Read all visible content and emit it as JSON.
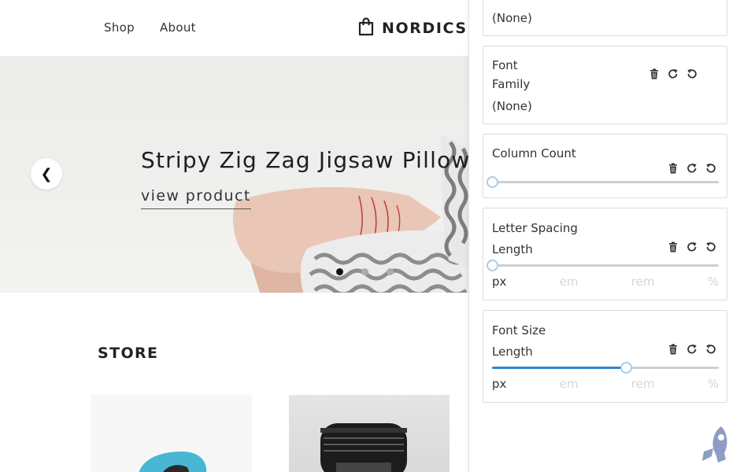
{
  "nav": {
    "links": [
      "Shop",
      "About"
    ],
    "brand": "NORDICS"
  },
  "hero": {
    "title": "Stripy Zig Zag Jigsaw Pillow",
    "link": "view product",
    "prev_symbol": "❮",
    "slides": 3,
    "active_slide": 0
  },
  "store": {
    "title": "STORE"
  },
  "panel": {
    "top_value": "(None)",
    "font_family": {
      "label_line1": "Font",
      "label_line2": "Family",
      "value": "(None)"
    },
    "column_count": {
      "label": "Column Count",
      "level": 0
    },
    "letter_spacing": {
      "label": "Letter Spacing",
      "sublabel": "Length",
      "level": 0,
      "units": [
        "px",
        "em",
        "rem",
        "%"
      ],
      "selected_unit": "px"
    },
    "font_size": {
      "label": "Font Size",
      "sublabel": "Length",
      "level": 0.59,
      "units": [
        "px",
        "em",
        "rem",
        "%"
      ],
      "selected_unit": "px"
    },
    "accent_color": "#2b86d1",
    "rocket_color": "#8e9bc4"
  }
}
